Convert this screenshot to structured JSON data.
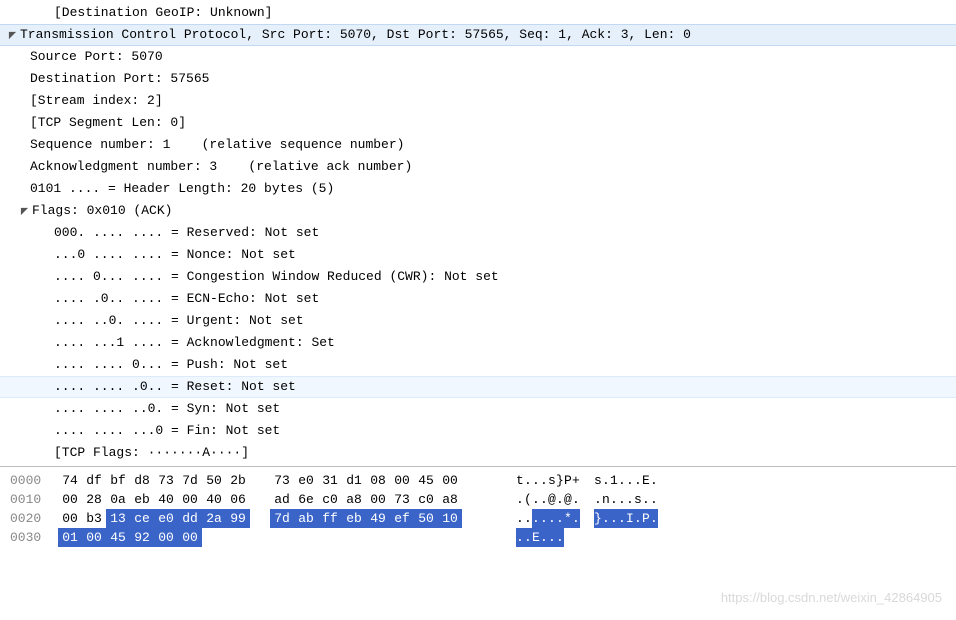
{
  "details": {
    "geoip": "[Destination GeoIP: Unknown]",
    "tcp_summary": "Transmission Control Protocol, Src Port: 5070, Dst Port: 57565, Seq: 1, Ack: 3, Len: 0",
    "source_port": "Source Port: 5070",
    "dest_port": "Destination Port: 57565",
    "stream_index": "[Stream index: 2]",
    "segment_len": "[TCP Segment Len: 0]",
    "seq_num": "Sequence number: 1    (relative sequence number)",
    "ack_num": "Acknowledgment number: 3    (relative ack number)",
    "hdr_len": "0101 .... = Header Length: 20 bytes (5)",
    "flags_summary": "Flags: 0x010 (ACK)",
    "flags": {
      "reserved": "000. .... .... = Reserved: Not set",
      "nonce": "...0 .... .... = Nonce: Not set",
      "cwr": ".... 0... .... = Congestion Window Reduced (CWR): Not set",
      "ecn": ".... .0.. .... = ECN-Echo: Not set",
      "urg": ".... ..0. .... = Urgent: Not set",
      "ack": ".... ...1 .... = Acknowledgment: Set",
      "psh": ".... .... 0... = Push: Not set",
      "rst": ".... .... .0.. = Reset: Not set",
      "syn": ".... .... ..0. = Syn: Not set",
      "fin": ".... .... ...0 = Fin: Not set"
    },
    "flags_str": "[TCP Flags: ·······A····]"
  },
  "hex": {
    "rows": [
      {
        "offset": "0000",
        "bytes": [
          "74",
          "df",
          "bf",
          "d8",
          "73",
          "7d",
          "50",
          "2b",
          "73",
          "e0",
          "31",
          "d1",
          "08",
          "00",
          "45",
          "00"
        ],
        "ascii": [
          "t",
          ".",
          ".",
          ".",
          "s",
          "}",
          "P",
          "+",
          "s",
          ".",
          "1",
          ".",
          ".",
          ".",
          "E",
          "."
        ],
        "sel_start": -1,
        "sel_end": -1
      },
      {
        "offset": "0010",
        "bytes": [
          "00",
          "28",
          "0a",
          "eb",
          "40",
          "00",
          "40",
          "06",
          "ad",
          "6e",
          "c0",
          "a8",
          "00",
          "73",
          "c0",
          "a8"
        ],
        "ascii": [
          ".",
          "(",
          ".",
          ".",
          "@",
          ".",
          "@",
          ".",
          ".",
          "n",
          ".",
          ".",
          ".",
          "s",
          ".",
          "."
        ],
        "sel_start": -1,
        "sel_end": -1
      },
      {
        "offset": "0020",
        "bytes": [
          "00",
          "b3",
          "13",
          "ce",
          "e0",
          "dd",
          "2a",
          "99",
          "7d",
          "ab",
          "ff",
          "eb",
          "49",
          "ef",
          "50",
          "10"
        ],
        "ascii": [
          ".",
          ".",
          ".",
          ".",
          ".",
          ".",
          "*",
          ".",
          "}",
          ".",
          ".",
          ".",
          "I",
          ".",
          "P",
          "."
        ],
        "sel_start": 2,
        "sel_end": 15
      },
      {
        "offset": "0030",
        "bytes": [
          "01",
          "00",
          "45",
          "92",
          "00",
          "00"
        ],
        "ascii": [
          ".",
          ".",
          "E",
          ".",
          ".",
          "."
        ],
        "sel_start": 0,
        "sel_end": 5
      }
    ]
  },
  "watermark": "https://blog.csdn.net/weixin_42864905"
}
